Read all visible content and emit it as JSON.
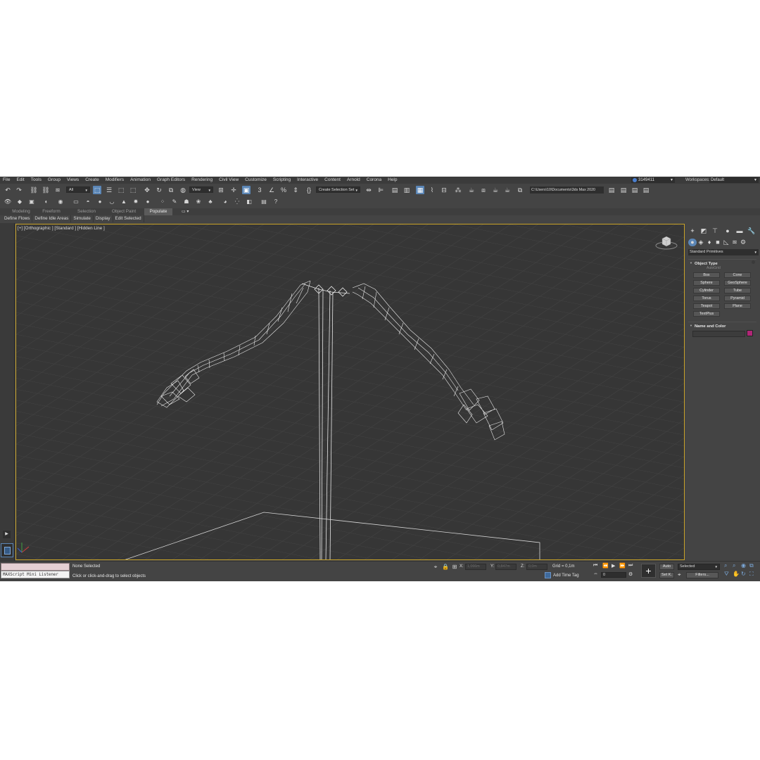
{
  "menu": [
    "File",
    "Edit",
    "Tools",
    "Group",
    "Views",
    "Create",
    "Modifiers",
    "Animation",
    "Graph Editors",
    "Rendering",
    "Civil View",
    "Customize",
    "Scripting",
    "Interactive",
    "Content",
    "Arnold",
    "Corona",
    "Help"
  ],
  "user": {
    "id": "3149411"
  },
  "workspace": {
    "label": "Workspaces:",
    "value": "Default"
  },
  "toolbar": {
    "selection_filter": "All",
    "reference_coord": "View",
    "selection_set": "Create Selection Set",
    "project_path": "C:\\Users\\10\\Documents\\3ds Max 2020"
  },
  "ribbon": {
    "tabs": [
      "Modeling",
      "Freeform",
      "Selection",
      "Object Paint",
      "Populate"
    ],
    "active_tab": "Populate",
    "panels": [
      "Define Flows",
      "Define Idle Areas",
      "Simulate",
      "Display",
      "Edit Selected"
    ]
  },
  "viewport": {
    "label": "[+] [Orthographic ] [Standard ] [Hidden Line ]"
  },
  "command_panel": {
    "category": "Standard Primitives",
    "object_type_title": "Object Type",
    "autogrid_label": "AutoGrid",
    "buttons": [
      "Box",
      "Cone",
      "Sphere",
      "GeoSphere",
      "Cylinder",
      "Tube",
      "Torus",
      "Pyramid",
      "Teapot",
      "Plane",
      "TextPlus"
    ],
    "name_color_title": "Name and Color",
    "object_color": "#b02677"
  },
  "status": {
    "maxscript_label": "MAXScript Mini Listener",
    "selection": "None Selected",
    "prompt": "Click or click-and-drag to select objects",
    "x_label": "X:",
    "x_value": "1,066m",
    "y_label": "Y:",
    "y_value": "0,847m",
    "z_label": "Z:",
    "z_value": "0,0m",
    "grid": "Grid = 0,1m",
    "add_time_tag": "Add Time Tag",
    "frame": "0",
    "auto_key": "Auto",
    "set_key": "Set K.",
    "key_mode": "Selected",
    "filters": "Filters..."
  },
  "colors": {
    "accent": "#5b86b6",
    "viewport_border": "#c8a228",
    "wireframe": "#e8e8e8"
  }
}
